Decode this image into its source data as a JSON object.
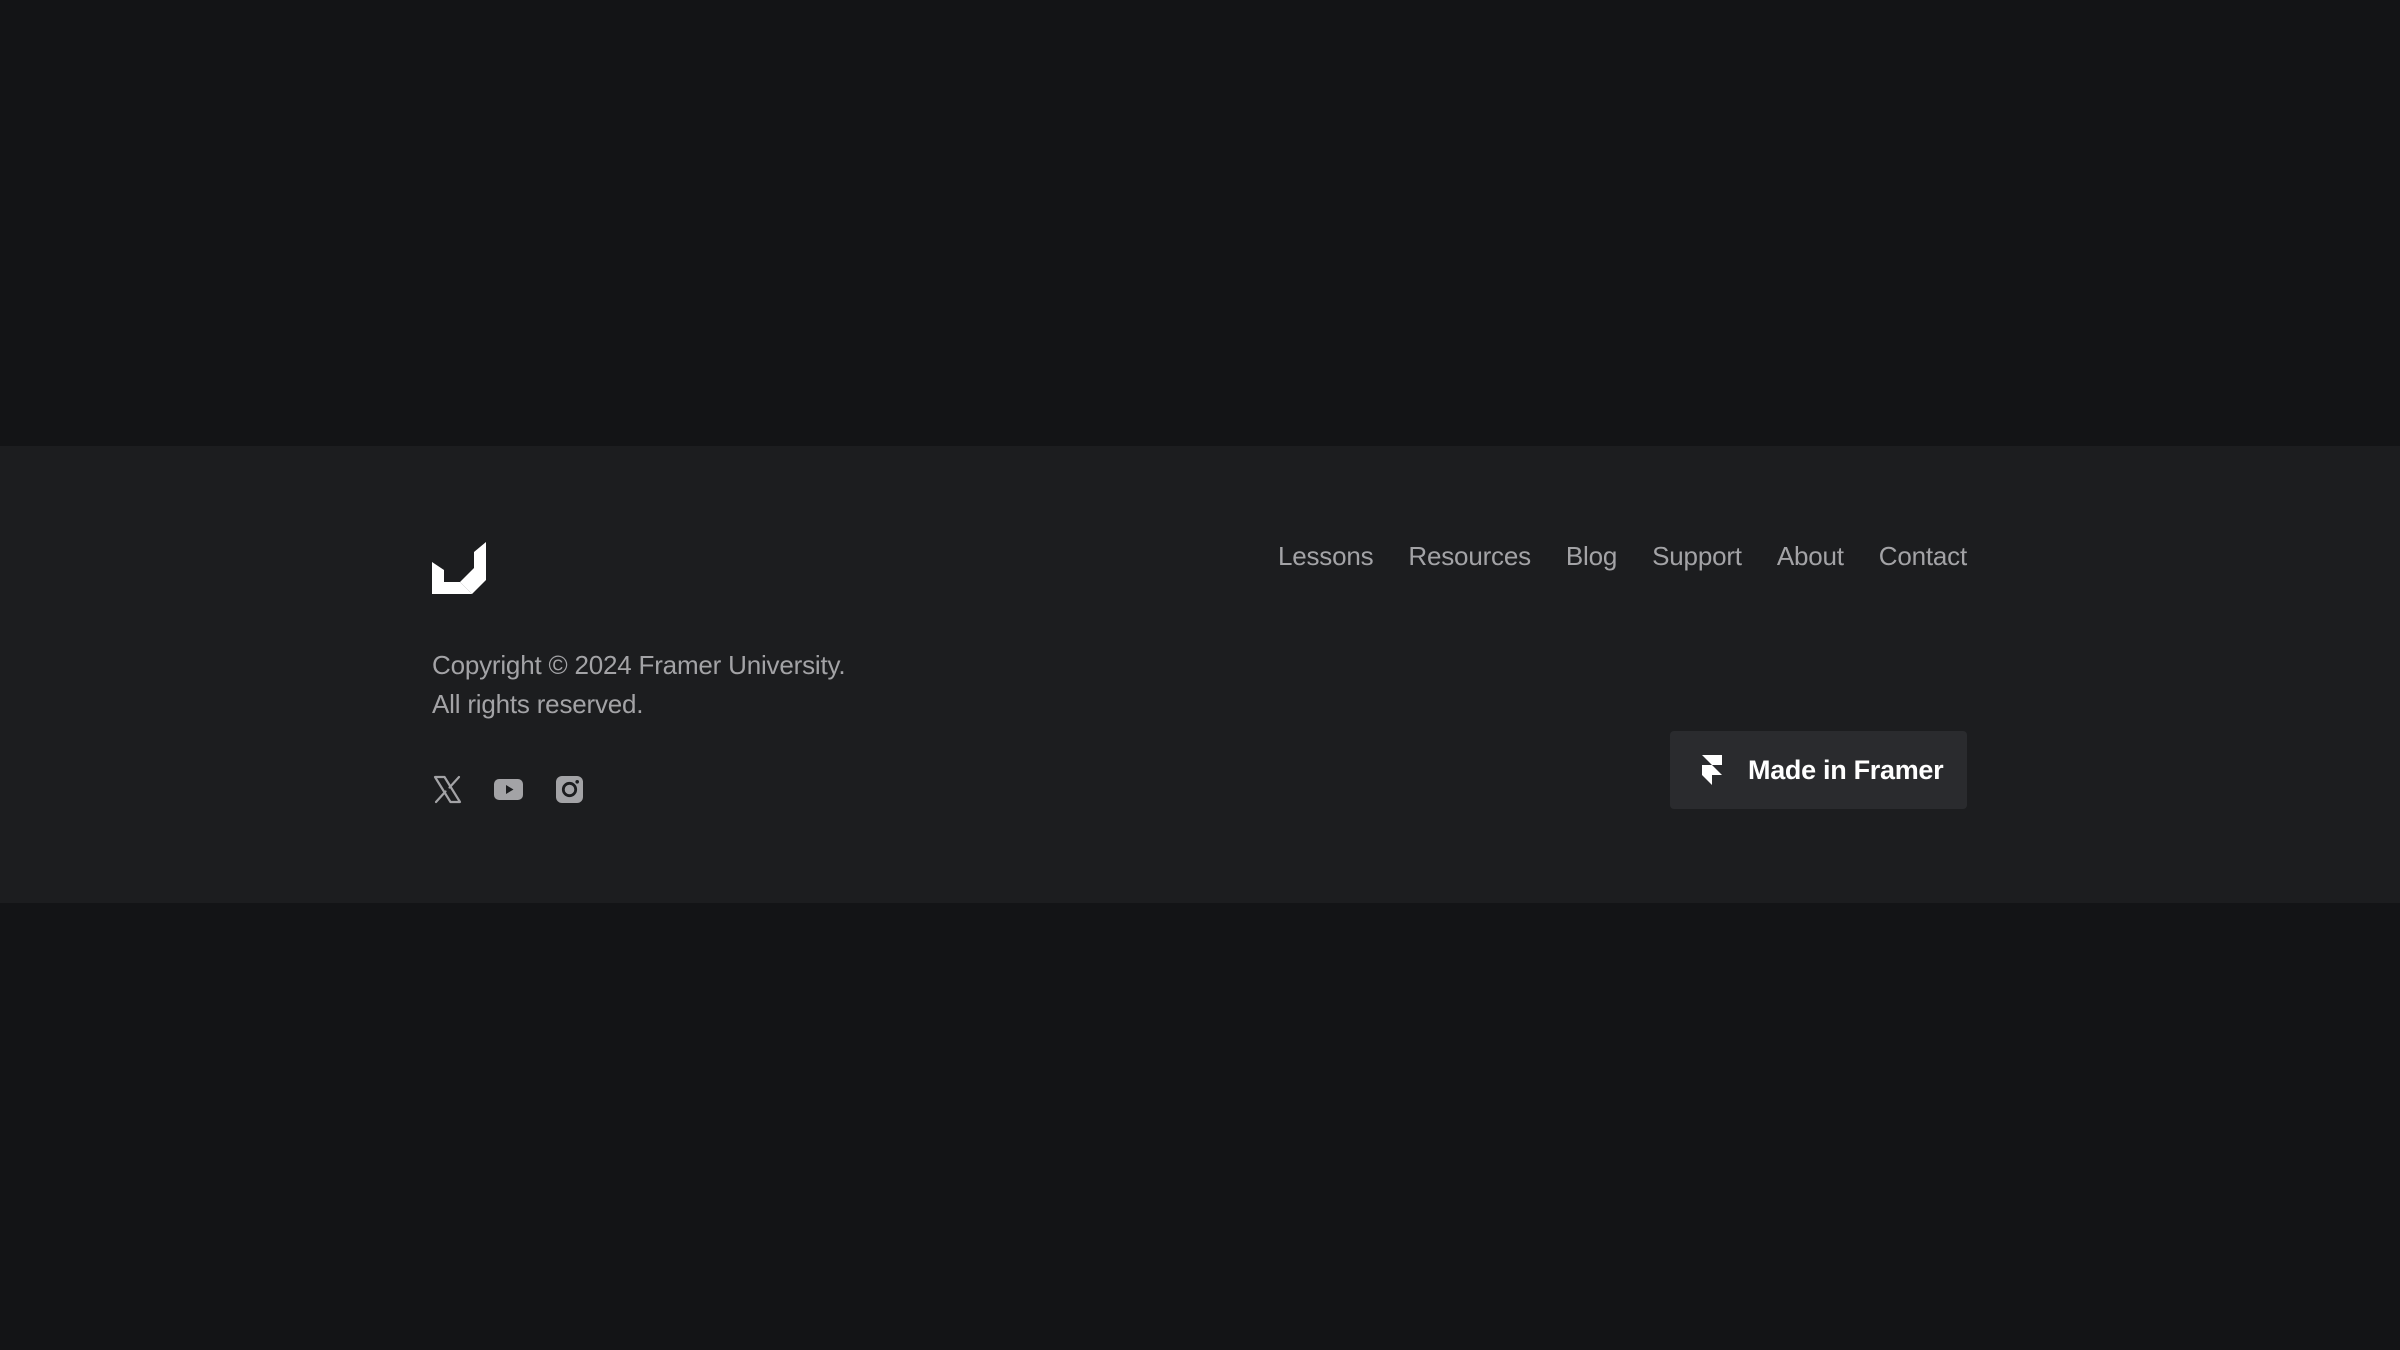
{
  "footer": {
    "logo": {
      "icon": "framer-university-logo-icon"
    },
    "copyright": {
      "line1": "Copyright © 2024 Framer University.",
      "line2": "All rights reserved."
    },
    "nav": [
      {
        "label": "Lessons"
      },
      {
        "label": "Resources"
      },
      {
        "label": "Blog"
      },
      {
        "label": "Support"
      },
      {
        "label": "About"
      },
      {
        "label": "Contact"
      }
    ],
    "socials": [
      {
        "icon": "x-twitter-icon"
      },
      {
        "icon": "youtube-icon"
      },
      {
        "icon": "instagram-icon"
      }
    ],
    "badge": {
      "label": "Made in Framer",
      "icon": "framer-icon"
    }
  },
  "colors": {
    "page_background": "#131416",
    "footer_background": "#1c1d1f",
    "muted_text": "#a3a3a6",
    "badge_background": "#2a2b2e",
    "badge_text": "#ffffff"
  }
}
